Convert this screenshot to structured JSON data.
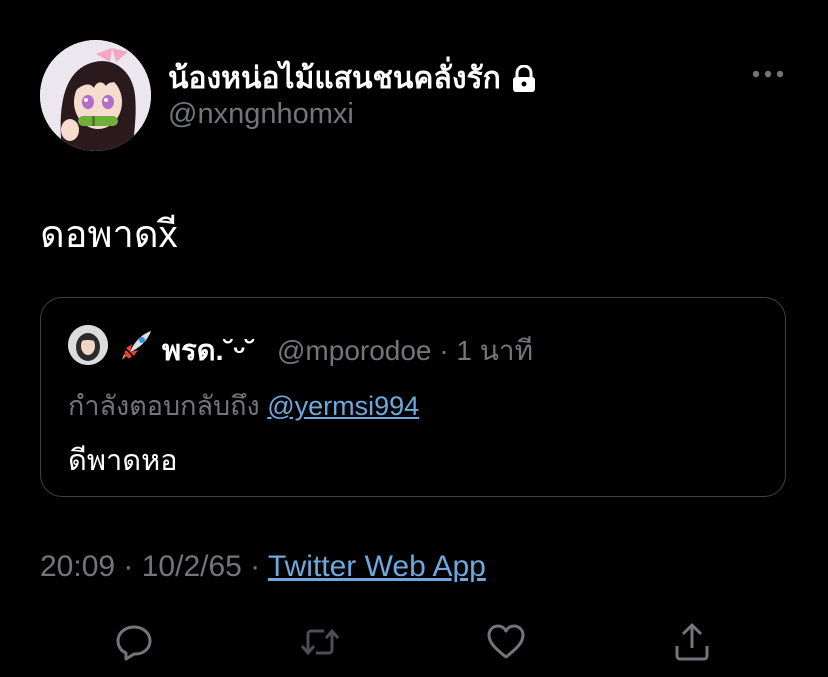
{
  "tweet": {
    "author": {
      "display_name": "น้องหน่อไม้แสนชนคลั่งรัก",
      "handle": "@nxngnhomxi",
      "protected_icon": "lock-icon",
      "avatar": "anime-avatar"
    },
    "text": "ดอพาดxี",
    "more_icon": "more-horizontal-icon"
  },
  "quote": {
    "avatar": "user-avatar",
    "emoji_icon": "rocket-icon",
    "display_name": "พรด.˘ᵕ˘",
    "handle_time": "@mporodoe · 1 นาที",
    "reply_prefix": "กำลังตอบกลับถึง",
    "reply_to": "@yermsi994",
    "text": "ดีพาดหอ"
  },
  "meta": {
    "time_date": "20:09 · 10/2/65 · ",
    "source": "Twitter Web App"
  },
  "actions": [
    {
      "name": "reply",
      "icon": "reply-icon"
    },
    {
      "name": "retweet",
      "icon": "retweet-icon"
    },
    {
      "name": "like",
      "icon": "heart-icon"
    },
    {
      "name": "share",
      "icon": "share-icon"
    }
  ],
  "colors": {
    "background": "#000000",
    "text_primary": "#ffffff",
    "text_secondary": "#71767b",
    "link": "#6ea8dc",
    "border": "#3e4144"
  }
}
